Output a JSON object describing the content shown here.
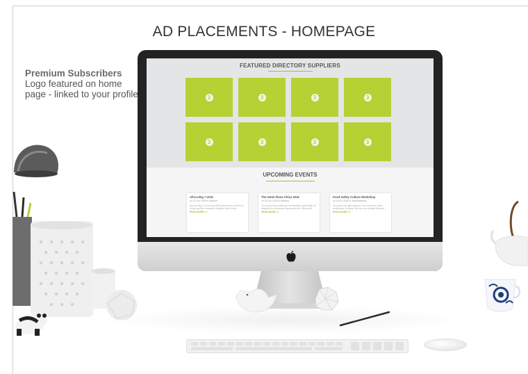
{
  "page": {
    "title": "AD PLACEMENTS - HOMEPAGE",
    "note_heading": "Premium Subscribers",
    "note_body": "Logo featured on home page - linked to your profile"
  },
  "screen": {
    "featured_title": "FEATURED DIRECTORY SUPPLIERS",
    "tiles": [
      "3",
      "3",
      "3",
      "3",
      "3",
      "3",
      "3",
      "3"
    ],
    "events_title": "UPCOMING EVENTS",
    "events": [
      {
        "title": "Africa Big 7 2018",
        "date": "on 24 Jun 2018 in Midrand",
        "text": "Africa's Big 7 is the only B2B trade show in Africa to bring together hundreds of global food & bev...",
        "more": "READ MORE >>"
      },
      {
        "title": "The Hotel Show Africa 2018",
        "date": "on 24 Jun 2018 in Midrand",
        "text": "The Hotel Show offers an unmissable opportunity for suppliers to showcase latest products, ideas and...",
        "more": "READ MORE >>"
      },
      {
        "title": "Food Safety Culture Workshop",
        "date": "on 26 Jul 2018 in Johannesburg",
        "text": "You have the right systems. You may even have certification in place. But are your people truly saf...",
        "more": "READ MORE >>"
      }
    ]
  },
  "colors": {
    "accent": "#b5d134",
    "underline": "#9dc52f",
    "screen_bg": "#e4e5e6",
    "monitor_bezel": "#232323"
  },
  "icons": [
    "apple-logo-icon"
  ]
}
